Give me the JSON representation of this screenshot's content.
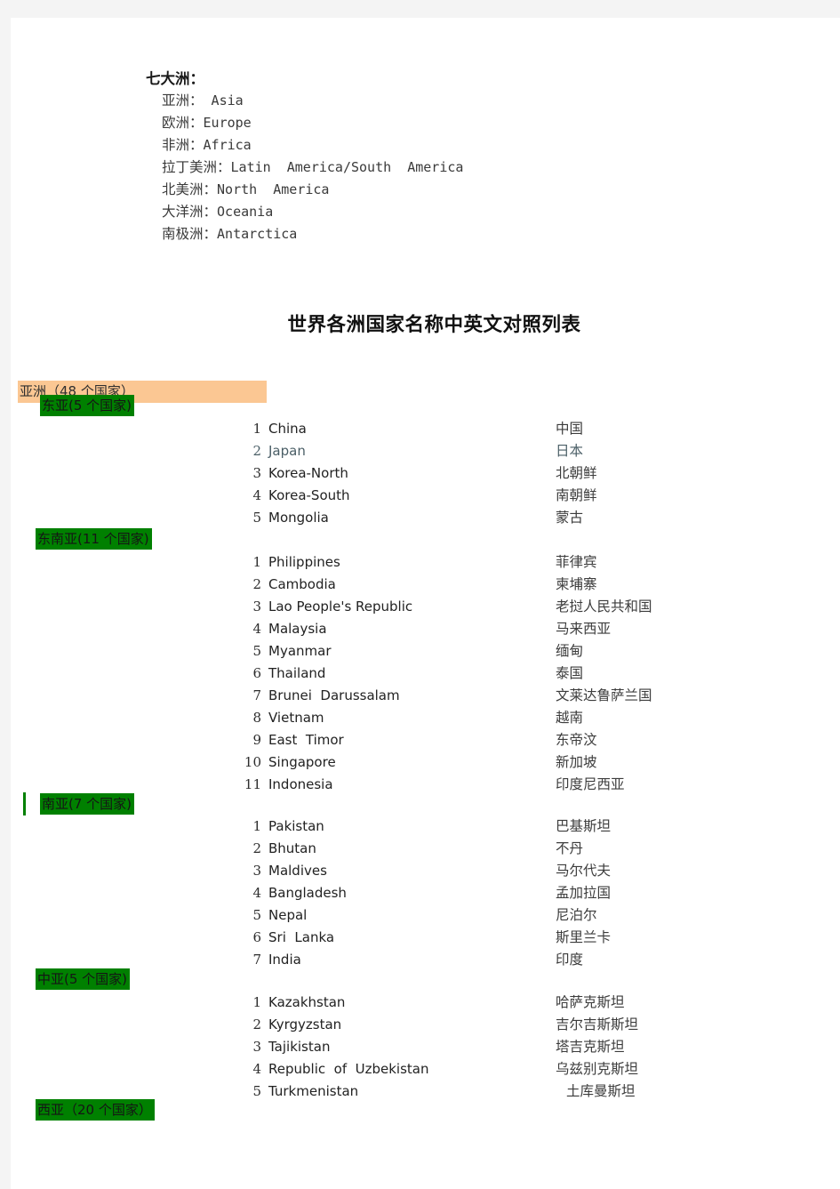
{
  "continents_block": {
    "heading": "七大洲：",
    "items": [
      {
        "cn": "亚洲：",
        "en": " Asia"
      },
      {
        "cn": "欧洲：",
        "en": "Europe"
      },
      {
        "cn": "非洲：",
        "en": "Africa"
      },
      {
        "cn": "拉丁美洲：",
        "en": "Latin  America/South  America"
      },
      {
        "cn": "北美洲：",
        "en": "North  America"
      },
      {
        "cn": "大洋洲：",
        "en": "Oceania"
      },
      {
        "cn": "南极洲：",
        "en": "Antarctica"
      }
    ]
  },
  "document_title": "世界各洲国家名称中英文对照列表",
  "colors": {
    "continent_band": "#fbc793",
    "region_header": "#008000",
    "page": "#ffffff",
    "backdrop": "#f4f4f4"
  },
  "continent_section": {
    "label": "亚洲（48 个国家）"
  },
  "regions": [
    {
      "label": "东亚(5 个国家)",
      "countries": [
        {
          "num": "1",
          "en": "China",
          "cn": "中国"
        },
        {
          "num": "2",
          "en": "Japan",
          "cn": "日本"
        },
        {
          "num": "3",
          "en": "Korea-North",
          "cn": "北朝鲜"
        },
        {
          "num": "4",
          "en": "Korea-South",
          "cn": "南朝鲜"
        },
        {
          "num": "5",
          "en": "Mongolia",
          "cn": "蒙古"
        }
      ]
    },
    {
      "label": "东南亚(11 个国家)",
      "countries": [
        {
          "num": "1",
          "en": "Philippines",
          "cn": "菲律宾"
        },
        {
          "num": "2",
          "en": "Cambodia",
          "cn": "柬埔寨"
        },
        {
          "num": "3",
          "en": "Lao People's Republic",
          "cn": "老挝人民共和国"
        },
        {
          "num": "4",
          "en": "Malaysia",
          "cn": "马来西亚"
        },
        {
          "num": "5",
          "en": "Myanmar",
          "cn": "缅甸"
        },
        {
          "num": "6",
          "en": "Thailand",
          "cn": "泰国"
        },
        {
          "num": "7",
          "en": "Brunei  Darussalam",
          "cn": "文莱达鲁萨兰国"
        },
        {
          "num": "8",
          "en": "Vietnam",
          "cn": "越南"
        },
        {
          "num": "9",
          "en": "East  Timor",
          "cn": "东帝汶"
        },
        {
          "num": "10",
          "en": "Singapore",
          "cn": "新加坡"
        },
        {
          "num": "11",
          "en": "Indonesia",
          "cn": "印度尼西亚"
        }
      ]
    },
    {
      "label": "南亚(7 个国家)",
      "countries": [
        {
          "num": "1",
          "en": "Pakistan",
          "cn": "巴基斯坦"
        },
        {
          "num": "2",
          "en": "Bhutan",
          "cn": "不丹"
        },
        {
          "num": "3",
          "en": "Maldives",
          "cn": "马尔代夫"
        },
        {
          "num": "4",
          "en": "Bangladesh",
          "cn": "孟加拉国"
        },
        {
          "num": "5",
          "en": "Nepal",
          "cn": "尼泊尔"
        },
        {
          "num": "6",
          "en": "Sri  Lanka",
          "cn": "斯里兰卡"
        },
        {
          "num": "7",
          "en": "India",
          "cn": "印度"
        }
      ]
    },
    {
      "label": "中亚(5 个国家)",
      "countries": [
        {
          "num": "1",
          "en": "Kazakhstan",
          "cn": "哈萨克斯坦"
        },
        {
          "num": "2",
          "en": "Kyrgyzstan",
          "cn": "吉尔吉斯斯坦"
        },
        {
          "num": "3",
          "en": "Tajikistan",
          "cn": "塔吉克斯坦"
        },
        {
          "num": "4",
          "en": "Republic  of  Uzbekistan",
          "cn": "乌兹别克斯坦"
        },
        {
          "num": "5",
          "en": "Turkmenistan",
          "cn": "土库曼斯坦"
        }
      ]
    },
    {
      "label": "西亚（20 个国家）",
      "countries": []
    }
  ]
}
